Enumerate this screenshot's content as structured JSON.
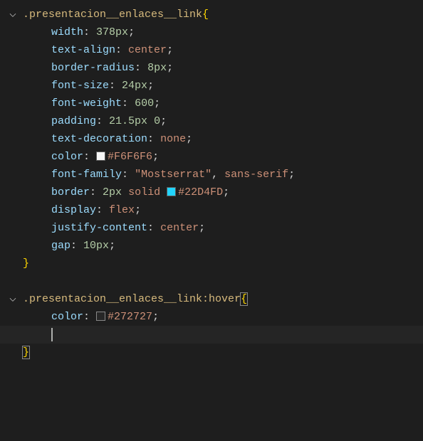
{
  "rule1": {
    "selector": ".presentacion__enlaces__link",
    "open": "{",
    "close": "}",
    "declarations": {
      "width": {
        "prop": "width",
        "num": "378px",
        "semi": ";"
      },
      "textAlign": {
        "prop": "text-align",
        "val": "center",
        "semi": ";"
      },
      "borderRadius": {
        "prop": "border-radius",
        "num": "8px",
        "semi": ";"
      },
      "fontSize": {
        "prop": "font-size",
        "num": "24px",
        "semi": ";"
      },
      "fontWeight": {
        "prop": "font-weight",
        "num": "600",
        "semi": ";"
      },
      "padding": {
        "prop": "padding",
        "num1": "21.5px",
        "num2": "0",
        "semi": ";"
      },
      "textDecoration": {
        "prop": "text-decoration",
        "val": "none",
        "semi": ";"
      },
      "color": {
        "prop": "color",
        "hex": "#F6F6F6",
        "semi": ";"
      },
      "fontFamily": {
        "prop": "font-family",
        "str": "\"Mostserrat\"",
        "comma": ",",
        "val": "sans-serif",
        "semi": ";"
      },
      "border": {
        "prop": "border",
        "num": "2px",
        "solid": "solid",
        "hex": "#22D4FD",
        "semi": ";"
      },
      "display": {
        "prop": "display",
        "val": "flex",
        "semi": ";"
      },
      "justifyContent": {
        "prop": "justify-content",
        "val": "center",
        "semi": ";"
      },
      "gap": {
        "prop": "gap",
        "num": "10px",
        "semi": ";"
      }
    }
  },
  "rule2": {
    "selector": ".presentacion__enlaces__link:hover",
    "open": "{",
    "close": "}",
    "declarations": {
      "color": {
        "prop": "color",
        "hex": "#272727",
        "semi": ";"
      }
    }
  },
  "colon": ":",
  "space": " "
}
